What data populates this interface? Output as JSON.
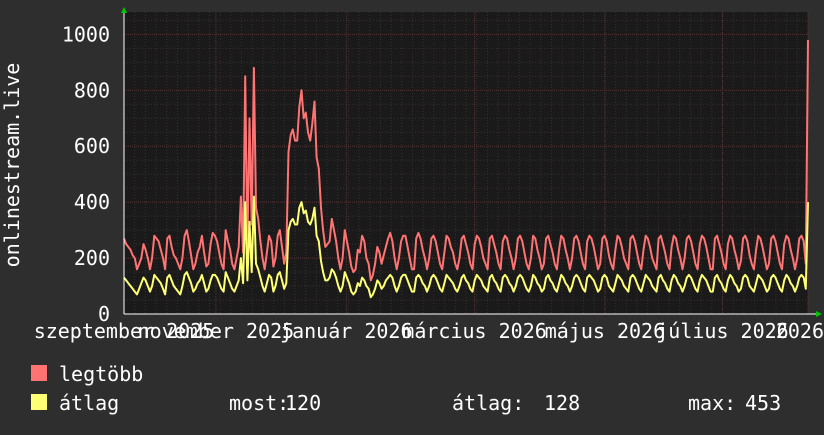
{
  "colors": {
    "background": "#2e2e2e",
    "plot_background": "#1a1a1a",
    "grid_minor": "#3a2e2e",
    "grid_major": "#5a3434",
    "axis_arrow": "#00c800",
    "max_series": "#ff7373",
    "avg_series": "#ffff73"
  },
  "chart_data": {
    "type": "line",
    "ylabel": "onlinestream.live",
    "ylim": [
      0,
      1080
    ],
    "yticks": [
      0,
      200,
      400,
      600,
      800,
      1000
    ],
    "ytick_labels": [
      "0",
      "200",
      "400",
      "600",
      "800",
      "1000"
    ],
    "xlim": [
      0,
      320
    ],
    "xtick_positions": [
      0,
      43,
      104,
      164,
      225,
      280,
      320
    ],
    "xtick_labels": [
      "szeptember 2025",
      "november 2025",
      "január 2026",
      "március 2026",
      "május 2026",
      "július 2026",
      "2026"
    ],
    "grid": true,
    "legend_placement": "bottom-left",
    "series": [
      {
        "name": "legtöbb",
        "color": "#ff7373",
        "values": [
          270,
          250,
          240,
          230,
          210,
          200,
          160,
          180,
          200,
          250,
          230,
          200,
          160,
          200,
          280,
          270,
          260,
          230,
          200,
          160,
          270,
          280,
          240,
          210,
          200,
          180,
          160,
          200,
          280,
          300,
          260,
          210,
          160,
          180,
          220,
          240,
          280,
          220,
          170,
          180,
          250,
          290,
          280,
          260,
          220,
          180,
          160,
          300,
          260,
          230,
          180,
          160,
          200,
          240,
          420,
          220,
          850,
          240,
          700,
          320,
          880,
          380,
          340,
          260,
          200,
          160,
          220,
          280,
          260,
          170,
          200,
          280,
          300,
          240,
          180,
          220,
          580,
          640,
          660,
          620,
          620,
          740,
          800,
          700,
          720,
          650,
          620,
          680,
          760,
          560,
          520,
          380,
          300,
          240,
          250,
          260,
          340,
          300,
          260,
          200,
          160,
          200,
          300,
          260,
          220,
          170,
          150,
          160,
          230,
          220,
          280,
          260,
          200,
          180,
          120,
          140,
          180,
          240,
          220,
          180,
          210,
          240,
          270,
          290,
          260,
          200,
          160,
          200,
          260,
          280,
          280,
          240,
          200,
          160,
          160,
          270,
          290,
          270,
          230,
          200,
          160,
          200,
          270,
          280,
          260,
          220,
          180,
          160,
          220,
          280,
          270,
          240,
          220,
          180,
          160,
          200,
          270,
          280,
          250,
          220,
          180,
          160,
          250,
          280,
          270,
          240,
          200,
          180,
          160,
          270,
          280,
          250,
          220,
          180,
          160,
          260,
          280,
          270,
          230,
          200,
          160,
          200,
          270,
          280,
          260,
          220,
          180,
          160,
          200,
          280,
          270,
          230,
          200,
          160,
          180,
          270,
          280,
          250,
          220,
          180,
          160,
          230,
          280,
          270,
          230,
          200,
          160,
          200,
          270,
          280,
          260,
          220,
          180,
          160,
          260,
          280,
          270,
          240,
          200,
          160,
          180,
          270,
          280,
          260,
          210,
          180,
          160,
          230,
          280,
          270,
          240,
          200,
          180,
          160,
          270,
          280,
          260,
          220,
          180,
          160,
          230,
          280,
          270,
          240,
          200,
          180,
          160,
          270,
          280,
          250,
          220,
          180,
          160,
          240,
          280,
          270,
          230,
          200,
          160,
          200,
          270,
          280,
          260,
          220,
          180,
          160,
          250,
          280,
          270,
          240,
          200,
          160,
          160,
          270,
          280,
          250,
          220,
          180,
          160,
          250,
          280,
          270,
          230,
          200,
          160,
          190,
          270,
          280,
          260,
          210,
          180,
          160,
          230,
          280,
          270,
          240,
          200,
          160,
          180,
          270,
          280,
          260,
          220,
          180,
          160,
          250,
          280,
          270,
          230,
          200,
          160,
          200,
          270,
          280,
          260,
          180,
          980
        ]
      },
      {
        "name": "átlag",
        "color": "#ffff73",
        "values": [
          130,
          120,
          110,
          100,
          90,
          80,
          70,
          90,
          110,
          130,
          120,
          100,
          80,
          100,
          140,
          130,
          120,
          110,
          90,
          70,
          130,
          140,
          120,
          100,
          90,
          80,
          70,
          100,
          140,
          150,
          130,
          110,
          80,
          90,
          110,
          120,
          140,
          110,
          80,
          90,
          120,
          140,
          140,
          130,
          110,
          90,
          80,
          150,
          130,
          110,
          90,
          80,
          100,
          120,
          200,
          110,
          400,
          120,
          330,
          150,
          420,
          180,
          160,
          130,
          100,
          80,
          110,
          140,
          130,
          80,
          100,
          140,
          150,
          120,
          90,
          110,
          300,
          330,
          340,
          320,
          320,
          380,
          400,
          360,
          370,
          330,
          320,
          340,
          380,
          280,
          260,
          190,
          150,
          120,
          120,
          130,
          160,
          150,
          130,
          100,
          80,
          100,
          150,
          130,
          110,
          80,
          70,
          80,
          110,
          100,
          130,
          120,
          100,
          90,
          60,
          70,
          90,
          120,
          110,
          90,
          100,
          120,
          130,
          140,
          130,
          100,
          80,
          100,
          130,
          140,
          140,
          120,
          100,
          80,
          80,
          130,
          140,
          130,
          110,
          100,
          80,
          100,
          130,
          140,
          130,
          110,
          90,
          80,
          110,
          140,
          130,
          120,
          110,
          90,
          80,
          100,
          130,
          140,
          120,
          110,
          90,
          80,
          120,
          140,
          130,
          120,
          100,
          90,
          80,
          130,
          140,
          120,
          110,
          90,
          80,
          130,
          140,
          130,
          110,
          100,
          80,
          100,
          130,
          140,
          130,
          110,
          90,
          80,
          100,
          140,
          130,
          110,
          100,
          80,
          90,
          130,
          140,
          120,
          110,
          90,
          80,
          110,
          140,
          130,
          110,
          100,
          80,
          100,
          130,
          140,
          130,
          110,
          90,
          80,
          130,
          140,
          130,
          120,
          100,
          80,
          90,
          130,
          140,
          130,
          100,
          90,
          80,
          110,
          140,
          130,
          120,
          100,
          90,
          80,
          130,
          140,
          130,
          110,
          90,
          80,
          110,
          140,
          130,
          120,
          100,
          90,
          80,
          130,
          140,
          120,
          110,
          90,
          80,
          120,
          140,
          130,
          110,
          100,
          80,
          100,
          130,
          140,
          130,
          110,
          90,
          80,
          120,
          140,
          130,
          120,
          100,
          80,
          80,
          130,
          140,
          120,
          110,
          90,
          80,
          120,
          140,
          130,
          110,
          100,
          80,
          90,
          130,
          140,
          130,
          100,
          90,
          80,
          110,
          140,
          130,
          120,
          100,
          80,
          90,
          130,
          140,
          130,
          110,
          90,
          80,
          120,
          140,
          130,
          110,
          100,
          80,
          100,
          130,
          140,
          130,
          90,
          400
        ]
      }
    ],
    "stats": {
      "now_label": "most:",
      "now_value": "120",
      "avg_label": "átlag:",
      "avg_value": "128",
      "max_label": "max:",
      "max_value": "453"
    }
  }
}
